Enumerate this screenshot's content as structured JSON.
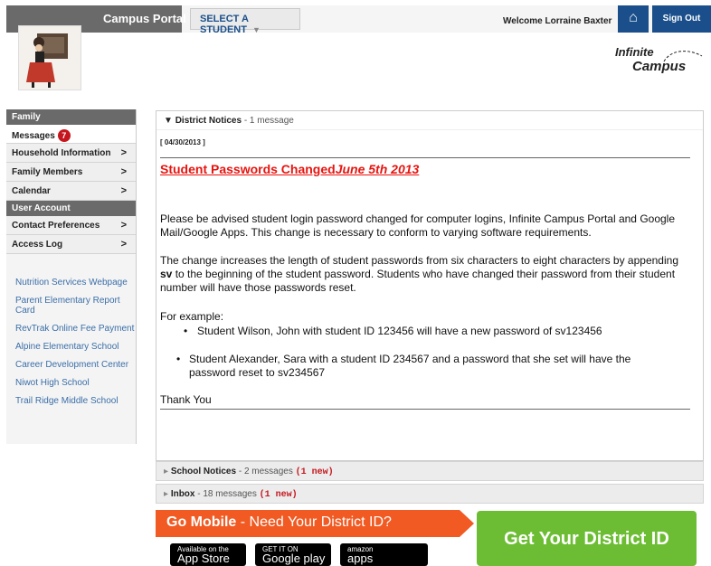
{
  "header": {
    "portal_title": "Campus Portal",
    "select_student": "SELECT A STUDENT",
    "welcome": "Welcome Lorraine Baxter",
    "sign_out": "Sign Out",
    "brand_line1": "Infinite",
    "brand_line2": "Campus"
  },
  "sidebar": {
    "family_header": "Family",
    "messages_label": "Messages",
    "messages_count": "7",
    "items": [
      "Household Information",
      "Family Members",
      "Calendar"
    ],
    "user_account_header": "User Account",
    "account_items": [
      "Contact Preferences",
      "Access Log"
    ],
    "links": [
      "Nutrition Services Webpage",
      "Parent Elementary Report Card",
      "RevTrak Online Fee Payment",
      "Alpine Elementary School",
      "Career Development Center",
      "Niwot High School",
      "Trail Ridge Middle School"
    ]
  },
  "district_notices": {
    "title": "District Notices",
    "count_text": " - 1 message",
    "date": "[ 04/30/2013 ]",
    "notice_title": "Student Passwords Changed",
    "notice_title_italic": "June 5th 2013",
    "para1": "Please be advised student login password changed for computer logins, Infinite Campus Portal and Google Mail/Google Apps.  This change is necessary to conform to varying software requirements.",
    "para2_a": "The change increases the length of student passwords from six characters to eight characters by appending ",
    "para2_bold": "sv",
    "para2_b": " to the beginning of the student password.  Students who have changed their password from their student number will have those passwords reset.",
    "example_label": "For example:",
    "bullet1": "Student Wilson, John with student ID 123456 will have a new password of sv123456",
    "bullet2": "Student Alexander, Sara with a student ID 234567 and a password that she set will have the password reset to sv234567",
    "thanks": "Thank You"
  },
  "school_notices": {
    "title": "School Notices",
    "count_text": " - 2 messages ",
    "new_text": "(1 new)"
  },
  "inbox": {
    "title": "Inbox",
    "count_text": " - 18 messages ",
    "new_text": "(1 new)"
  },
  "promo": {
    "go_mobile": "Go Mobile",
    "need_id": " - Need Your District ID?",
    "app_store_small": "Available on the",
    "app_store_big": "App Store",
    "google_small": "GET IT ON",
    "google_big": "Google play",
    "amazon_small": "amazon",
    "amazon_big": "apps",
    "get_id": "Get Your District ID"
  }
}
